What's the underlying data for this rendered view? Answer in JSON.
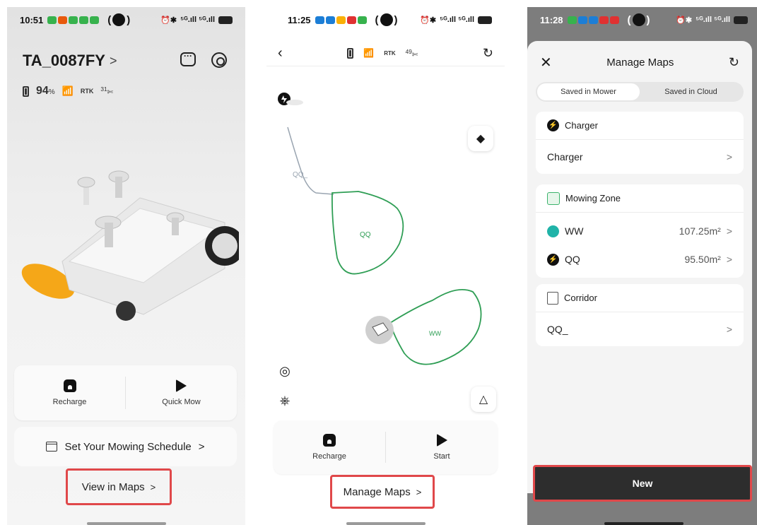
{
  "panel1": {
    "status": {
      "time": "10:51",
      "signal": "⁵ᴳ.ıll ⁵ᴳ.ıll"
    },
    "device_name": "TA_0087FY",
    "battery": "94",
    "battery_unit": "%",
    "rtk": "RTK",
    "satellites": "31",
    "actions": {
      "recharge": "Recharge",
      "quick_mow": "Quick Mow"
    },
    "schedule_label": "Set Your Mowing Schedule",
    "view_maps_label": "View in Maps"
  },
  "panel2": {
    "status": {
      "time": "11:25",
      "signal": "⁵ᴳ.ıll ⁵ᴳ.ıll"
    },
    "rtk": "RTK",
    "satellites": "49",
    "map": {
      "corridor_label": "QQ_",
      "zone_qq": "QQ",
      "zone_ww": "WW"
    },
    "actions": {
      "recharge": "Recharge",
      "start": "Start"
    },
    "manage_maps_label": "Manage Maps"
  },
  "panel3": {
    "status": {
      "time": "11:28",
      "signal": "⁵ᴳ.ıll ⁵ᴳ.ıll"
    },
    "title": "Manage Maps",
    "tabs": [
      "Saved in Mower",
      "Saved in Cloud"
    ],
    "charger_section": {
      "heading": "Charger",
      "item": "Charger"
    },
    "zone_section": {
      "heading": "Mowing Zone",
      "items": [
        {
          "name": "WW",
          "area": "107.25m²"
        },
        {
          "name": "QQ",
          "area": "95.50m²"
        }
      ]
    },
    "corridor_section": {
      "heading": "Corridor",
      "item": "QQ_"
    },
    "new_label": "New"
  },
  "colors": {
    "highlight": "#e0484a",
    "zone_green": "#3bb36b",
    "accent_teal": "#20b3a8"
  }
}
